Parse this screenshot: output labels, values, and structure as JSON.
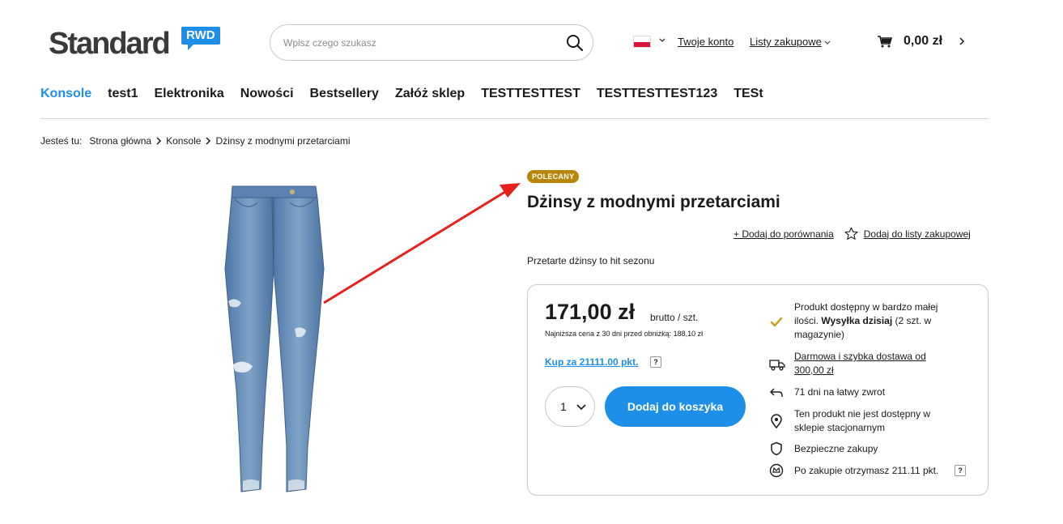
{
  "header": {
    "logo_text": "Standard",
    "logo_badge": "RWD",
    "search_placeholder": "Wpisz czego szukasz",
    "account_label": "Twoje konto",
    "shopping_lists_label": "Listy zakupowe",
    "cart_total": "0,00 zł"
  },
  "nav": {
    "items": [
      "Konsole",
      "test1",
      "Elektronika",
      "Nowości",
      "Bestsellery",
      "Załóż sklep",
      "TESTTESTTEST",
      "TESTTESTTEST123",
      "TESt"
    ]
  },
  "breadcrumb": {
    "prefix": "Jesteś tu:",
    "home": "Strona główna",
    "category": "Konsole",
    "current": "Dżinsy z modnymi przetarciami"
  },
  "product": {
    "badge": "POLECANY",
    "title": "Dżinsy z modnymi przetarciami",
    "compare_label": "+ Dodaj do porównania",
    "shopping_list_label": "Dodaj do listy zakupowej",
    "description": "Przetarte dżinsy to hit sezonu",
    "price": "171,00 zł",
    "price_unit": "brutto / szt.",
    "lowest_price_note": "Najniższa cena z 30 dni przed obniżką: 188,10 zł",
    "buy_with_points": "Kup za 21111.00 pkt.",
    "help_mark": "?",
    "quantity": "1",
    "add_to_cart": "Dodaj do koszyka"
  },
  "features": {
    "availability_1": "Produkt dostępny w bardzo małej ilości.",
    "availability_bold": "Wysyłka dzisiaj",
    "availability_2": "(2 szt. w magazynie)",
    "delivery": "Darmowa i szybka dostawa od 300,00 zł",
    "returns": "71 dni na łatwy zwrot",
    "store": "Ten produkt nie jest dostępny w sklepie stacjonarnym",
    "secure": "Bezpieczne zakupy",
    "points": "Po zakupie otrzymasz 211.11 pkt."
  },
  "colors": {
    "accent": "#1e8fe8",
    "badge": "#b8860b",
    "annotation_arrow": "#e8201a",
    "check": "#c9a227"
  }
}
